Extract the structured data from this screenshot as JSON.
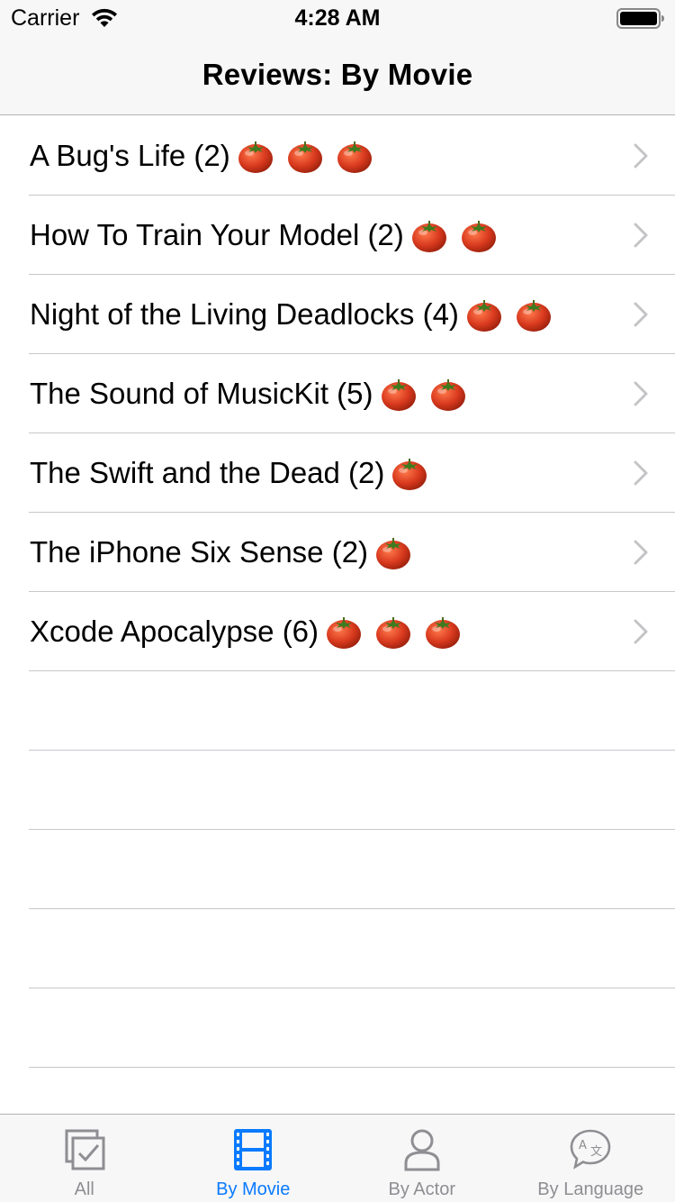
{
  "status_bar": {
    "carrier": "Carrier",
    "time": "4:28 AM"
  },
  "nav": {
    "title": "Reviews: By Movie"
  },
  "movies": [
    {
      "title": "A Bug's Life (2)",
      "tomatoes": 3
    },
    {
      "title": "How To Train Your Model (2)",
      "tomatoes": 2
    },
    {
      "title": "Night of the Living Deadlocks (4)",
      "tomatoes": 2
    },
    {
      "title": "The Sound of MusicKit (5)",
      "tomatoes": 2
    },
    {
      "title": "The Swift and the Dead (2)",
      "tomatoes": 1
    },
    {
      "title": "The iPhone Six Sense (2)",
      "tomatoes": 1
    },
    {
      "title": "Xcode Apocalypse (6)",
      "tomatoes": 3
    }
  ],
  "tabs": [
    {
      "label": "All",
      "icon": "checklist-icon",
      "active": false
    },
    {
      "label": "By Movie",
      "icon": "film-icon",
      "active": true
    },
    {
      "label": "By Actor",
      "icon": "person-icon",
      "active": false
    },
    {
      "label": "By Language",
      "icon": "translate-bubble-icon",
      "active": false
    }
  ],
  "colors": {
    "accent": "#0a7aff",
    "inactive_tab": "#8e8e93",
    "bar_background": "#f7f7f7",
    "separator": "#c8c7cc",
    "tomato": "#d93a1e"
  }
}
